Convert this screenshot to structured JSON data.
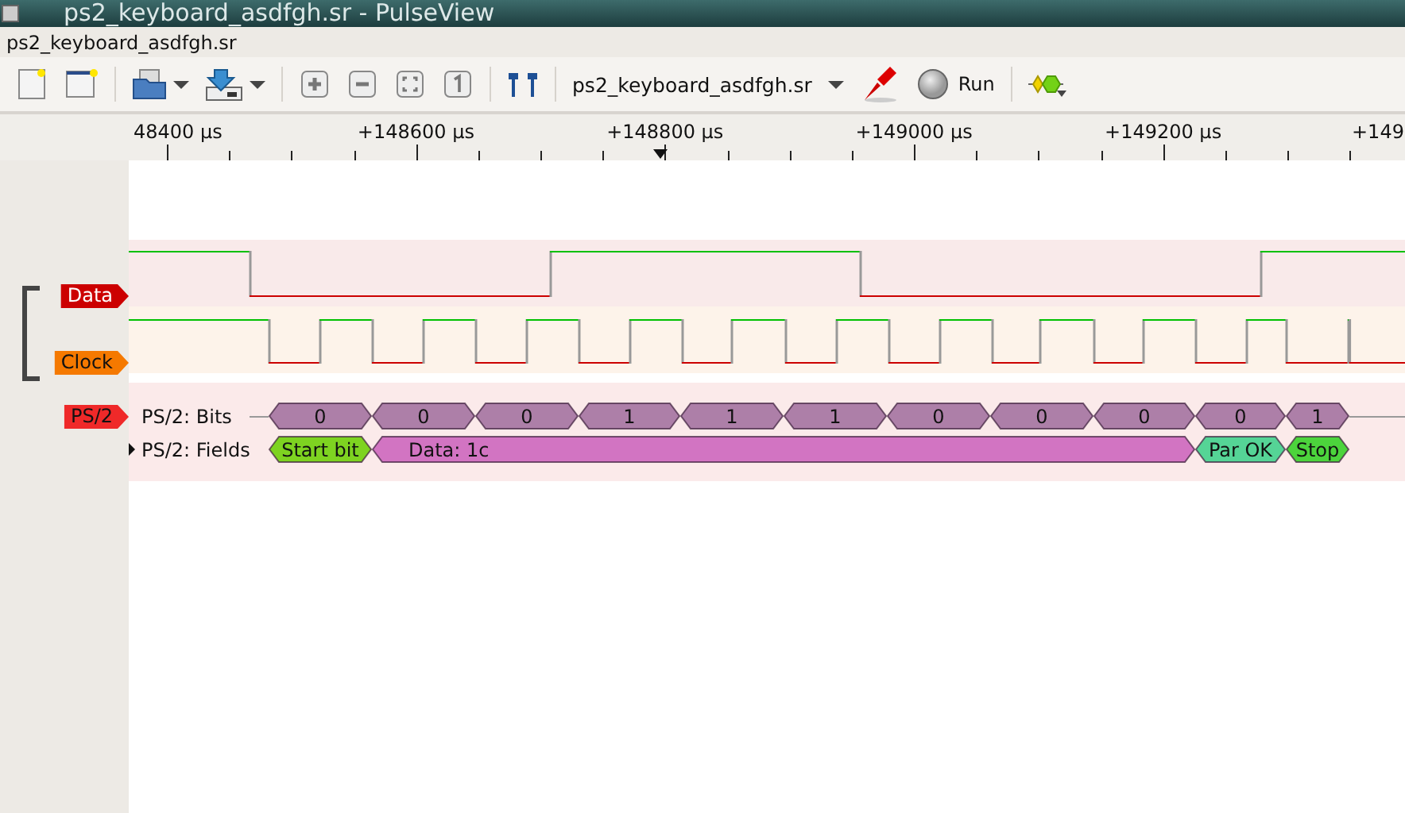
{
  "window": {
    "title": "ps2_keyboard_asdfgh.sr - PulseView"
  },
  "session": {
    "title": "ps2_keyboard_asdfgh.sr"
  },
  "toolbar": {
    "device": "ps2_keyboard_asdfgh.sr",
    "run_button": "Run"
  },
  "ruler": {
    "ticks": [
      "48400 µs",
      "+148600 µs",
      "+148800 µs",
      "+149000 µs",
      "+149200 µs",
      "+149"
    ]
  },
  "signals": [
    {
      "name": "Data",
      "color": "#cc0000",
      "kind": "data"
    },
    {
      "name": "Clock",
      "color": "#f57900",
      "kind": "clock"
    }
  ],
  "decoder": {
    "name": "PS/2",
    "color": "#ef2929",
    "rows": [
      {
        "label": "PS/2: Bits",
        "kind": "bits",
        "annotations": [
          {
            "text": "0"
          },
          {
            "text": "0"
          },
          {
            "text": "0"
          },
          {
            "text": "1"
          },
          {
            "text": "1"
          },
          {
            "text": "1"
          },
          {
            "text": "0"
          },
          {
            "text": "0"
          },
          {
            "text": "0"
          },
          {
            "text": "0"
          },
          {
            "text": "1"
          }
        ]
      },
      {
        "label": "PS/2: Fields",
        "kind": "fields",
        "annotations": [
          {
            "text": "Start bit",
            "kind": "start"
          },
          {
            "text": "Data: 1c",
            "kind": "data"
          },
          {
            "text": "Par OK",
            "kind": "parity"
          },
          {
            "text": "Stop",
            "kind": "stop"
          }
        ]
      }
    ]
  }
}
